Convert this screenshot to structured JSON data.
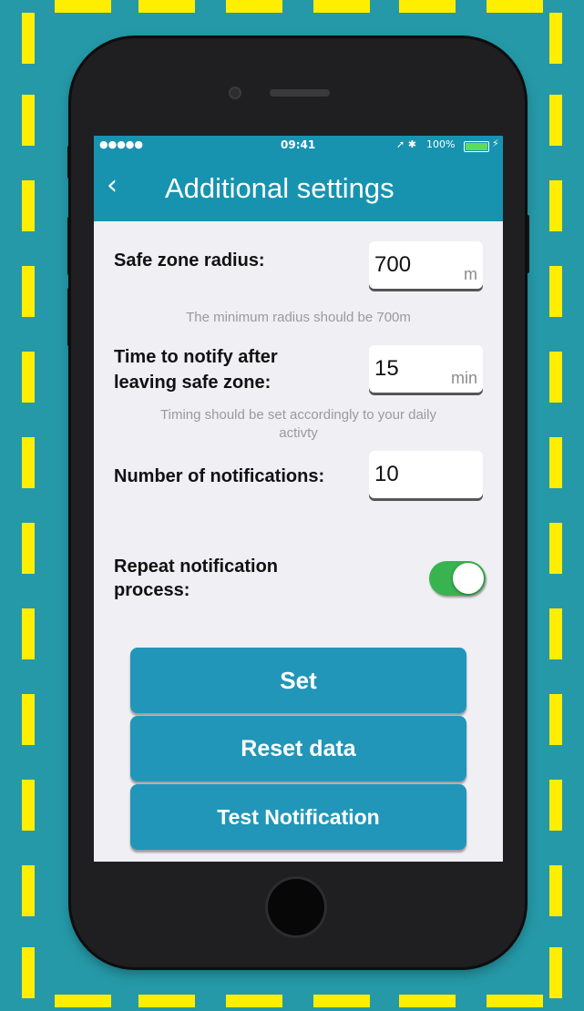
{
  "status_bar": {
    "signal": "●●●●● ",
    "time": "09:41",
    "bluetooth": "➚ ✱",
    "battery": "100%",
    "charging": "⚡"
  },
  "header": {
    "back_icon": "chevron-left-icon",
    "back_glyph": "‹",
    "title": "Additional settings"
  },
  "settings": {
    "safe_zone": {
      "label": "Safe zone radius:",
      "value": "700",
      "unit": "m",
      "hint": "The minimum radius should be 700m"
    },
    "notify_time": {
      "label_line1": "Time to notify after",
      "label_line2": "leaving safe zone:",
      "value": "15",
      "unit": "min",
      "hint_line1": "Timing should be set accordingly to your daily",
      "hint_line2": "activty"
    },
    "notifications": {
      "label": "Number of notifications:",
      "value": "10"
    },
    "repeat": {
      "label_line1": "Repeat notification",
      "label_line2": "process:",
      "enabled": true
    }
  },
  "buttons": {
    "set": "Set",
    "reset": "Reset data",
    "test": "Test Notification"
  },
  "colors": {
    "background": "#2599a8",
    "dash": "#ffee00",
    "accent": "#2196b9",
    "toggle_on": "#38b34f"
  }
}
